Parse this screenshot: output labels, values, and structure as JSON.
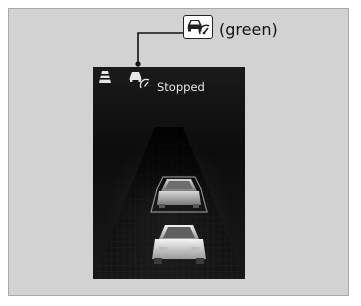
{
  "callout": {
    "text": "(green)",
    "icon": "adaptive-cruise-following-icon"
  },
  "display": {
    "status_text": "Stopped",
    "road_icon": "lane-road-icon",
    "indicator_icon": "adaptive-cruise-following-icon",
    "lead_vehicle": "lead-vehicle-icon",
    "own_vehicle": "own-vehicle-icon"
  },
  "colors": {
    "indicator_state": "green",
    "panel_background": "#d2d2d2",
    "screen_background": "#111111"
  }
}
